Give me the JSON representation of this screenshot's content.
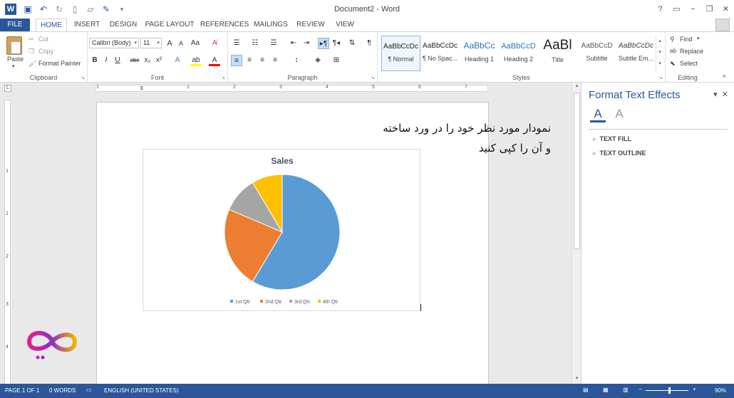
{
  "titlebar": {
    "title": "Document2 - Word",
    "app_icon": "W",
    "controls": [
      "?",
      "▭",
      "−",
      "❐",
      "✕"
    ]
  },
  "qat": [
    "save-icon",
    "undo-icon",
    "redo-icon",
    "new-icon",
    "open-icon",
    "edit-icon",
    "customize-icon"
  ],
  "tabs": {
    "file": "FILE",
    "items": [
      "HOME",
      "INSERT",
      "DESIGN",
      "PAGE LAYOUT",
      "REFERENCES",
      "MAILINGS",
      "REVIEW",
      "VIEW"
    ],
    "active": "HOME"
  },
  "clipboard": {
    "label": "Clipboard",
    "paste": "Paste",
    "cut": "Cut",
    "copy": "Copy",
    "format_painter": "Format Painter"
  },
  "font": {
    "label": "Font",
    "name": "Calibri (Body)",
    "size": "11",
    "grow": "A",
    "shrink": "A",
    "case": "Aa",
    "bold": "B",
    "italic": "I",
    "underline": "U",
    "strike": "abc",
    "sub": "x₂",
    "sup": "x²"
  },
  "paragraph": {
    "label": "Paragraph",
    "pilcrow": "¶"
  },
  "styles": {
    "label": "Styles",
    "items": [
      {
        "preview": "AaBbCcDc",
        "name": "¶ Normal"
      },
      {
        "preview": "AaBbCcDc",
        "name": "¶ No Spac..."
      },
      {
        "preview": "AaBbCc",
        "name": "Heading 1"
      },
      {
        "preview": "AaBbCcD",
        "name": "Heading 2"
      },
      {
        "preview": "AaBl",
        "name": "Title"
      },
      {
        "preview": "AaBbCcD",
        "name": "Subtitle"
      },
      {
        "preview": "AaBbCcDc",
        "name": "Subtle Em..."
      }
    ]
  },
  "editing": {
    "label": "Editing",
    "find": "Find",
    "replace": "Replace",
    "select": "Select"
  },
  "document": {
    "line1": "نمودار مورد نظر خود را در ورد ساخته",
    "line2": "و آن را کپی کنید"
  },
  "ruler": {
    "h": [
      "1",
      "1",
      "2",
      "3",
      "4",
      "5",
      "6",
      "7"
    ],
    "v": [
      "1",
      "1",
      "2",
      "3",
      "4"
    ]
  },
  "chart_data": {
    "type": "pie",
    "title": "Sales",
    "categories": [
      "1st Qtr",
      "2nd Qtr",
      "3rd Qtr",
      "4th Qtr"
    ],
    "values": [
      8.2,
      3.2,
      1.4,
      1.2
    ],
    "colors": [
      "#5b9bd5",
      "#ed7d31",
      "#a5a5a5",
      "#ffc000"
    ],
    "legend": "bottom"
  },
  "pane": {
    "title": "Format Text Effects",
    "section1": "TEXT FILL",
    "section2": "TEXT OUTLINE"
  },
  "status": {
    "page": "PAGE 1 OF 1",
    "words": "0 WORDS",
    "lang": "ENGLISH (UNITED STATES)",
    "zoom": "90%"
  },
  "colors": {
    "brand": "#2b579a"
  }
}
